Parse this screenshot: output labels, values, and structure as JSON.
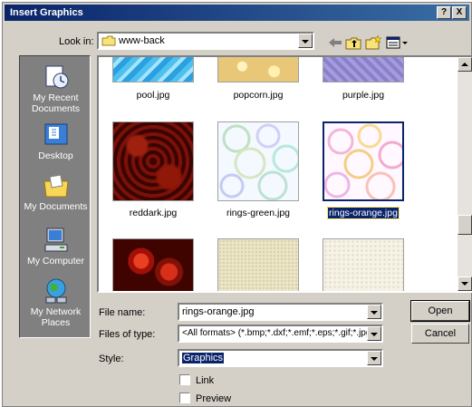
{
  "dialog": {
    "title": "Insert Graphics",
    "help_button": "?",
    "close_button": "X"
  },
  "lookin": {
    "label": "Look in:",
    "value": "www-back"
  },
  "places": [
    {
      "label": "My Recent Documents",
      "icon": "recent-documents-icon"
    },
    {
      "label": "Desktop",
      "icon": "desktop-icon"
    },
    {
      "label": "My Documents",
      "icon": "my-documents-icon"
    },
    {
      "label": "My Computer",
      "icon": "my-computer-icon"
    },
    {
      "label": "My Network Places",
      "icon": "network-places-icon"
    }
  ],
  "files": [
    {
      "name": "pool.jpg"
    },
    {
      "name": "popcorn.jpg"
    },
    {
      "name": "purple.jpg"
    },
    {
      "name": "reddark.jpg"
    },
    {
      "name": "rings-green.jpg"
    },
    {
      "name": "rings-orange.jpg",
      "selected": true
    },
    {
      "name": ""
    },
    {
      "name": ""
    },
    {
      "name": ""
    }
  ],
  "form": {
    "filename_label": "File name:",
    "filename_value": "rings-orange.jpg",
    "filetype_label": "Files of type:",
    "filetype_value": "<All formats> (*.bmp;*.dxf;*.emf;*.eps;*.gif;*.jpg;*",
    "style_label": "Style:",
    "style_value": "Graphics",
    "link_label": "Link",
    "preview_label": "Preview"
  },
  "buttons": {
    "open": "Open",
    "cancel": "Cancel"
  },
  "colors": {
    "title_bar": "#0a246a",
    "selection": "#0a246a",
    "places_bar": "#808080",
    "dialog_face": "#d4d0c8"
  }
}
